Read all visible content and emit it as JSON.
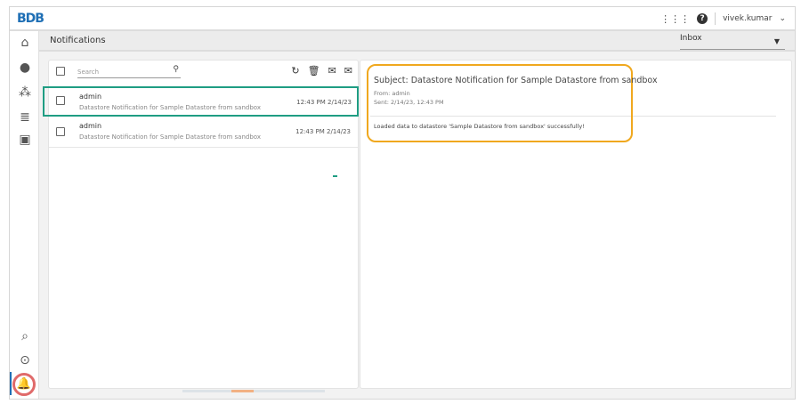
{
  "header": {
    "logo": "BDB",
    "user": "vivek.kumar",
    "icons": [
      "apps-grid-icon",
      "help-icon",
      "chevron-down-icon"
    ]
  },
  "sidebar": {
    "icons": [
      "home-icon",
      "user-settings-icon",
      "users-group-icon",
      "datastore-icon",
      "presentation-icon",
      "report-search-icon",
      "data-search-icon",
      "notification-bell-icon"
    ],
    "active": "notification-bell-icon"
  },
  "page": {
    "title": "Notifications",
    "folder": "Inbox"
  },
  "list": {
    "search_placeholder": "Search",
    "toolbar": [
      "refresh-icon",
      "delete-icon",
      "mark-unread-icon",
      "mark-read-icon"
    ],
    "items": [
      {
        "sender": "admin",
        "subject": "Datastore Notification for Sample Datastore from sandbox",
        "time": "12:43 PM 2/14/23",
        "selected": true
      },
      {
        "sender": "admin",
        "subject": "Datastore Notification for Sample Datastore from sandbox",
        "time": "12:43 PM 2/14/23",
        "selected": false
      }
    ]
  },
  "detail": {
    "subject": "Subject: Datastore Notification for Sample Datastore from sandbox",
    "from": "From: admin",
    "sent": "Sent: 2/14/23, 12:43 PM",
    "body": "Loaded data to datastore 'Sample Datastore from sandbox' successfully!"
  },
  "colors": {
    "selected_border": "#1f9d83",
    "highlight": "#f0a81e",
    "accent": "#1f6fb5"
  }
}
